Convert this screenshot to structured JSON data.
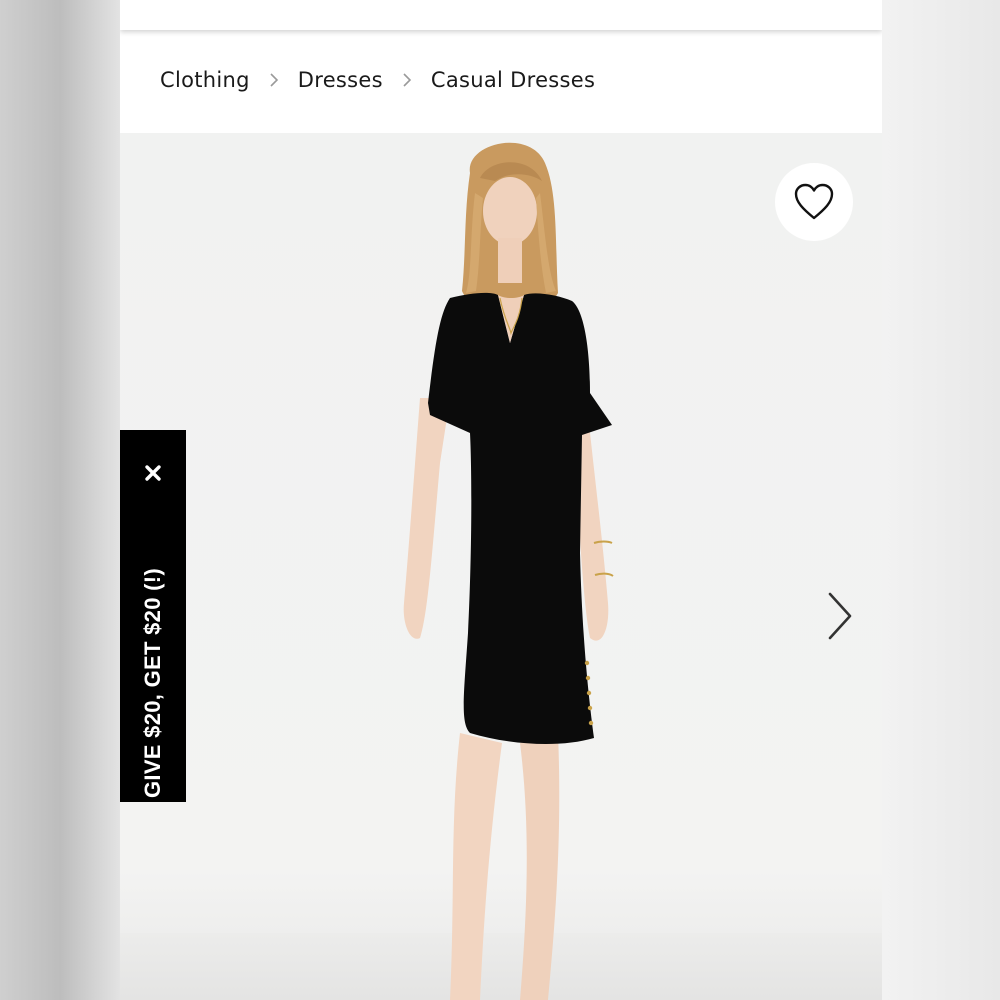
{
  "breadcrumb": {
    "items": [
      {
        "label": "Clothing"
      },
      {
        "label": "Dresses"
      },
      {
        "label": "Casual Dresses"
      }
    ],
    "separator_icon": "chevron-right-icon"
  },
  "product_image": {
    "favorite_icon": "heart-outline-icon",
    "next_icon": "chevron-right-icon",
    "alt": "Woman in black v-neck short sleeve shift dress"
  },
  "promo": {
    "text": "GIVE $20, GET $20 (!)",
    "close_icon": "close-icon"
  },
  "colors": {
    "text": "#1a1a1a",
    "promo_bg": "#000000",
    "hero_bg": "#f1f2f1"
  }
}
